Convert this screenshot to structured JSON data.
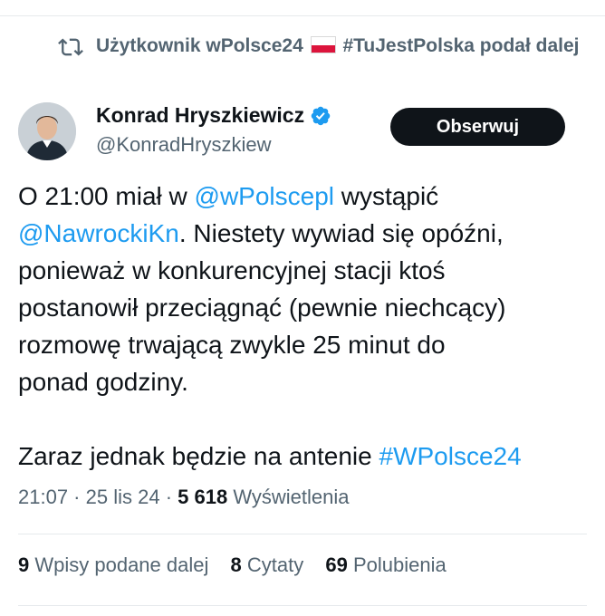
{
  "retweet": {
    "text_before_flag": "Użytkownik wPolsce24",
    "flag_icon": "poland-flag",
    "text_after_flag": "#TuJestPolska podał dalej"
  },
  "author": {
    "display_name": "Konrad Hryszkiewicz",
    "verified_icon": "verified-badge",
    "handle": "@KonradHryszkiew",
    "follow_label": "Obserwuj"
  },
  "tweet": {
    "line1_a": "O 21:00 miał w ",
    "line1_mention": "@wPolscepl",
    "line1_b": " wystąpić",
    "line2_mention": "@NawrockiKn",
    "line2_b": ". Niestety wywiad się opóźni,",
    "line3": "ponieważ w konkurencyjnej stacji ktoś",
    "line4": "postanowił przeciągnąć (pewnie niechcący)",
    "line5": "rozmowę trwającą zwykle 25 minut do",
    "line6": "ponad godziny.",
    "line8_a": "Zaraz jednak będzie na antenie ",
    "line8_hashtag": "#WPolsce24"
  },
  "meta": {
    "time": "21:07",
    "sep1": " · ",
    "date": "25 lis 24",
    "sep2": " · ",
    "views_count": "5 618",
    "views_label": " Wyświetlenia"
  },
  "stats": {
    "reposts_count": "9",
    "reposts_label": " Wpisy podane dalej",
    "quotes_count": "8",
    "quotes_label": " Cytaty",
    "likes_count": "69",
    "likes_label": " Polubienia"
  },
  "colors": {
    "link": "#1d9bf0",
    "secondary_text": "#536471",
    "primary_text": "#0f1419",
    "button_bg": "#0f1419"
  }
}
